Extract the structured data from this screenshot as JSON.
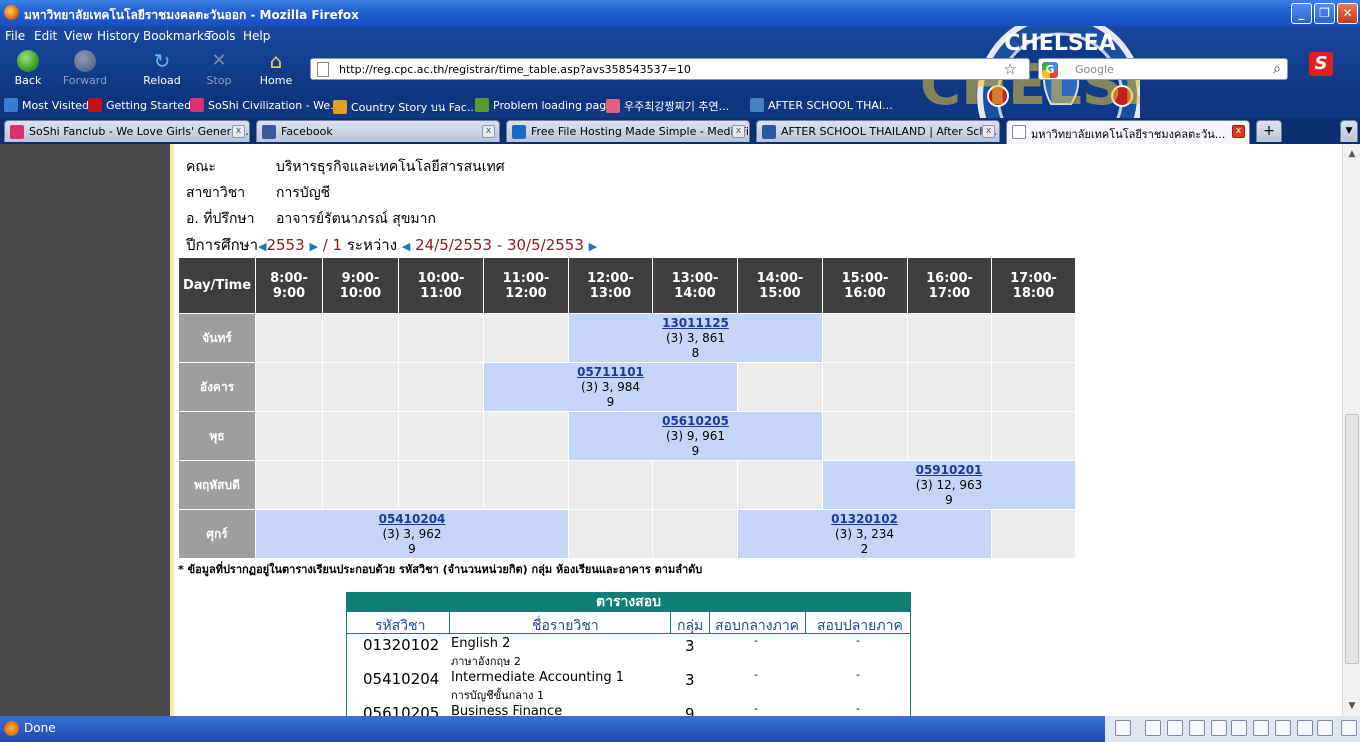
{
  "window": {
    "title": "มหาวิทยาลัยเทคโนโลยีราชมงคลตะวันออก - Mozilla Firefox"
  },
  "menu": [
    "File",
    "Edit",
    "View",
    "History",
    "Bookmarks",
    "Tools",
    "Help"
  ],
  "nav": {
    "back": "Back",
    "forward": "Forward",
    "reload": "Reload",
    "stop": "Stop",
    "home": "Home"
  },
  "address": {
    "url": "http://reg.cpc.ac.th/registrar/time_table.asp?avs358543537=10"
  },
  "search": {
    "placeholder": "Google",
    "engine_letter": "G"
  },
  "addon_badge": "S",
  "bookmarks": [
    {
      "label": "Most Visited",
      "color": "#3a7bd5"
    },
    {
      "label": "Getting Started",
      "color": "#c41010"
    },
    {
      "label": "SoShi Civilization - We...",
      "color": "#d83070"
    },
    {
      "label": "Country Story บน Fac...",
      "color": "#e0a020"
    },
    {
      "label": "Problem loading page",
      "color": "#5a9a2a"
    },
    {
      "label": "우주최강짱찌기 추연...",
      "color": "#e06080"
    },
    {
      "label": "AFTER SCHOOL THAI...",
      "color": "#4a80c0"
    }
  ],
  "tabs": [
    {
      "label": "SoShi Fanclub - We Love Girls' Generati...",
      "color": "#d83070",
      "close": "x"
    },
    {
      "label": "Facebook",
      "color": "#3b5998",
      "close": "x"
    },
    {
      "label": "Free File Hosting Made Simple - MediaFire",
      "color": "#1a6ac8",
      "close": "x"
    },
    {
      "label": "AFTER SCHOOL THAILAND | After Sch...",
      "color": "#2a5aa0",
      "close": "x"
    },
    {
      "label": "มหาวิทยาลัยเทคโนโลยีราชมงคลตะวัน...",
      "color": "#ffffff",
      "close": "x"
    }
  ],
  "newtab": "+",
  "logo": {
    "text1": "CHELSEA",
    "text2": "FC",
    "crest": "CHELSEA"
  },
  "info": [
    {
      "label": "คณะ",
      "value": "บริหารธุรกิจและเทคโนโลยีสารสนเทศ"
    },
    {
      "label": "สาขาวิชา",
      "value": "การบัญชี"
    },
    {
      "label": "อ. ที่ปรึกษา",
      "value": "อาจารย์รัตนาภรณ์ สุขมาก"
    }
  ],
  "year": {
    "label": "ปีการศึกษา",
    "year": "2553",
    "sep": "/",
    "term": "1",
    "between": "ระหว่าง",
    "from": "24/5/2553",
    "dash": "-",
    "to": "30/5/2553"
  },
  "timetable": {
    "corner": "Day/Time",
    "slots": [
      "8:00-9:00",
      "9:00-10:00",
      "10:00-11:00",
      "11:00-12:00",
      "12:00-13:00",
      "13:00-14:00",
      "14:00-15:00",
      "15:00-16:00",
      "16:00-17:00",
      "17:00-18:00"
    ],
    "days": [
      {
        "name": "จันทร์",
        "cells": [
          {
            "span": 1
          },
          {
            "span": 1
          },
          {
            "span": 1
          },
          {
            "span": 1
          },
          {
            "span": 3,
            "code": "13011125",
            "detail": "(3) 3, 861",
            "room": "8"
          },
          {
            "span": 1
          },
          {
            "span": 1
          },
          {
            "span": 1
          }
        ]
      },
      {
        "name": "อังคาร",
        "cells": [
          {
            "span": 1
          },
          {
            "span": 1
          },
          {
            "span": 1
          },
          {
            "span": 3,
            "code": "05711101",
            "detail": "(3) 3, 984",
            "room": "9"
          },
          {
            "span": 1
          },
          {
            "span": 1
          },
          {
            "span": 1
          },
          {
            "span": 1
          }
        ]
      },
      {
        "name": "พุธ",
        "cells": [
          {
            "span": 1
          },
          {
            "span": 1
          },
          {
            "span": 1
          },
          {
            "span": 1
          },
          {
            "span": 3,
            "code": "05610205",
            "detail": "(3) 9, 961",
            "room": "9"
          },
          {
            "span": 1
          },
          {
            "span": 1
          },
          {
            "span": 1
          }
        ]
      },
      {
        "name": "พฤหัสบดี",
        "cells": [
          {
            "span": 1
          },
          {
            "span": 1
          },
          {
            "span": 1
          },
          {
            "span": 1
          },
          {
            "span": 1
          },
          {
            "span": 1
          },
          {
            "span": 1
          },
          {
            "span": 3,
            "code": "05910201",
            "detail": "(3) 12, 963",
            "room": "9"
          }
        ]
      },
      {
        "name": "ศุกร์",
        "cells": [
          {
            "span": 4,
            "code": "05410204",
            "detail": "(3) 3, 962",
            "room": "9"
          },
          {
            "span": 1
          },
          {
            "span": 1
          },
          {
            "span": 3,
            "code": "01320102",
            "detail": "(3) 3, 234",
            "room": "2"
          },
          {
            "span": 1
          }
        ]
      }
    ]
  },
  "note": "* ข้อมูลที่ปรากฏอยู่ในตารางเรียนประกอบด้วย รหัสวิชา (จำนวนหน่วยกิต) กลุ่ม ห้องเรียนและอาคาร ตามลำดับ",
  "exam": {
    "title": "ตารางสอบ",
    "headers": [
      "รหัสวิชา",
      "ชื่อรายวิชา",
      "กลุ่ม",
      "สอบกลางภาค",
      "สอบปลายภาค"
    ],
    "rows": [
      {
        "code": "01320102",
        "name": "English 2",
        "name_th": "ภาษาอังกฤษ 2",
        "group": "3",
        "mid": "-",
        "final": "-"
      },
      {
        "code": "05410204",
        "name": "Intermediate Accounting 1",
        "name_th": "การบัญชีขั้นกลาง 1",
        "group": "3",
        "mid": "-",
        "final": "-"
      },
      {
        "code": "05610205",
        "name": "Business Finance",
        "name_th": "",
        "group": "9",
        "mid": "-",
        "final": "-"
      }
    ]
  },
  "status": {
    "text": "Done"
  }
}
